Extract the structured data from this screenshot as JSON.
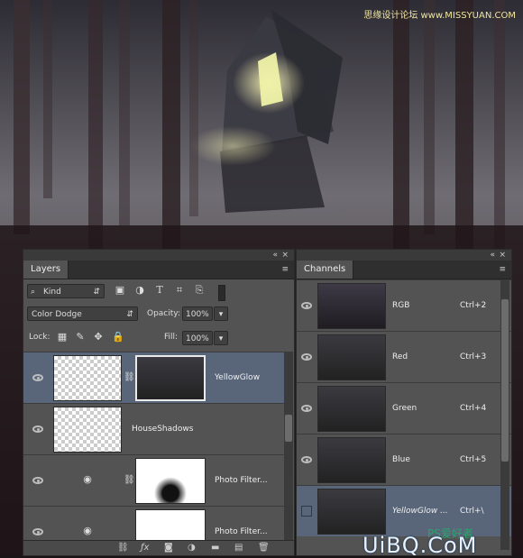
{
  "watermark_top": "思缘设计论坛 www.MISSYUAN.COM",
  "layers_panel": {
    "collapse_glyph": "«",
    "close_glyph": "×",
    "menu_glyph": "≡",
    "tab_label": "Layers",
    "filter_kind": "Kind",
    "blend_mode": "Color Dodge",
    "opacity_label": "Opacity:",
    "opacity_value": "100%",
    "lock_label": "Lock:",
    "fill_label": "Fill:",
    "fill_value": "100%",
    "layers": [
      {
        "name": "YellowGlow"
      },
      {
        "name": "HouseShadows"
      },
      {
        "name": "Photo Filter..."
      },
      {
        "name": "Photo Filter..."
      }
    ]
  },
  "channels_panel": {
    "tab_label": "Channels",
    "channels": [
      {
        "name": "RGB",
        "shortcut": "Ctrl+2"
      },
      {
        "name": "Red",
        "shortcut": "Ctrl+3"
      },
      {
        "name": "Green",
        "shortcut": "Ctrl+4"
      },
      {
        "name": "Blue",
        "shortcut": "Ctrl+5"
      },
      {
        "name": "YellowGlow ...",
        "shortcut": "Ctrl+\\"
      }
    ]
  },
  "watermark_bottom": {
    "brand": "UiBQ.CoM",
    "sub": "PS爱好者"
  },
  "colors": {
    "panel": "#535353",
    "selected": "#59667a"
  }
}
